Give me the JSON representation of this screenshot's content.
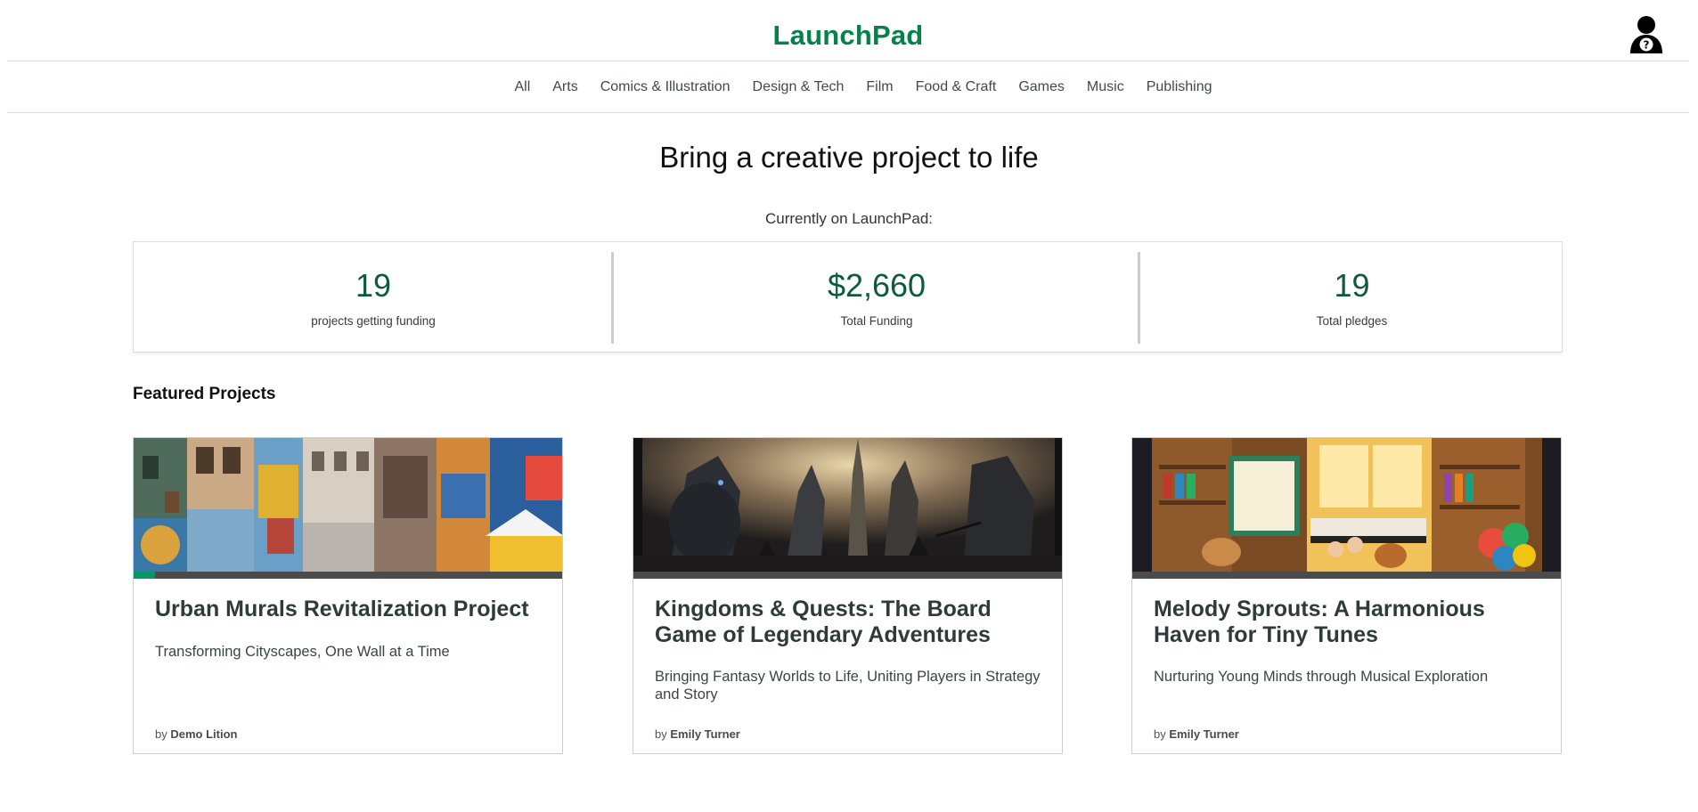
{
  "header": {
    "logo": "LaunchPad"
  },
  "nav": {
    "items": [
      "All",
      "Arts",
      "Comics & Illustration",
      "Design & Tech",
      "Film",
      "Food & Craft",
      "Games",
      "Music",
      "Publishing"
    ]
  },
  "hero": {
    "title": "Bring a creative project to life",
    "subtitle": "Currently on LaunchPad:"
  },
  "stats": [
    {
      "value": "19",
      "label": "projects getting funding"
    },
    {
      "value": "$2,660",
      "label": "Total Funding"
    },
    {
      "value": "19",
      "label": "Total pledges"
    }
  ],
  "featured": {
    "title": "Featured Projects",
    "cards": [
      {
        "title": "Urban Murals Revitalization Project",
        "blurb": "Transforming Cityscapes, One Wall at a Time",
        "by": "by",
        "author": "Demo Lition",
        "progress": 0.05
      },
      {
        "title": "Kingdoms & Quests: The Board Game of Legendary Adventures",
        "blurb": "Bringing Fantasy Worlds to Life, Uniting Players in Strategy and Story",
        "by": "by",
        "author": "Emily Turner",
        "progress": 0
      },
      {
        "title": "Melody Sprouts: A Harmonious Haven for Tiny Tunes",
        "blurb": "Nurturing Young Minds through Musical Exploration",
        "by": "by",
        "author": "Emily Turner",
        "progress": 0
      }
    ]
  },
  "colors": {
    "brand": "#058249",
    "stat_number": "#0e5b3c",
    "progress_fill": "#059669",
    "progress_track": "#4b4b4b"
  }
}
